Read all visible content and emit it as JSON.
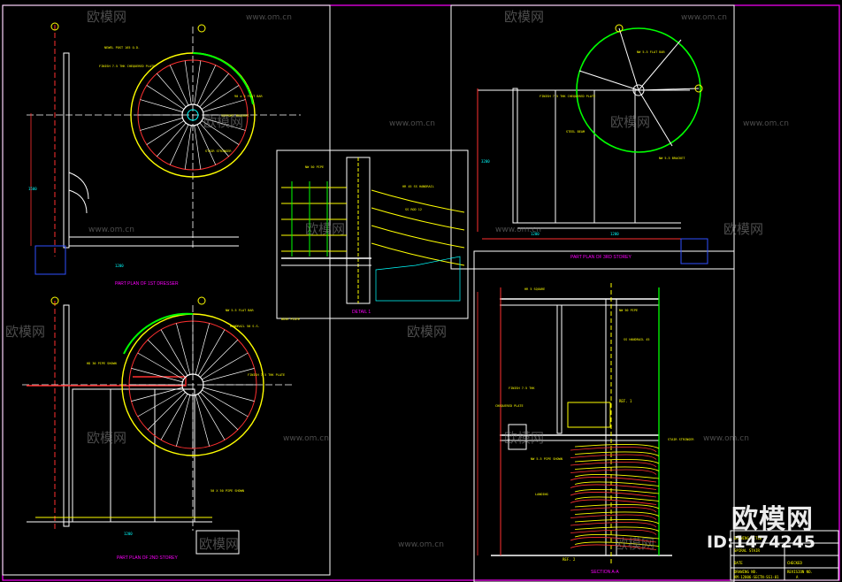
{
  "drawing": {
    "plan_titles": [
      "PART PLAN OF 1ST DRESSER",
      "PART PLAN OF 2ND STOREY",
      "PART PLAN OF 3RD STOREY"
    ],
    "section_title": "SECTION A-A",
    "detail_title": "DETAIL 1",
    "scale_note": "SCALE 1:50",
    "ref_labels": [
      "REF. 1",
      "REF. 2"
    ],
    "grid_bubbles": [
      "B",
      "C",
      "D"
    ],
    "dims": [
      "1200",
      "1200",
      "1500",
      "3200",
      "1200",
      "1200"
    ]
  },
  "title_block": {
    "rows": [
      "DRAWING TITLE",
      "SPIRAL STAIR",
      "DATE",
      "CHECKED",
      "DRAWING NO.",
      "REVISION NO.",
      "KM-12006-SECTN-SS1-01",
      "A"
    ]
  },
  "watermark": {
    "brand": "欧模网",
    "site": "www.om.cn",
    "id_label": "ID:1474245"
  },
  "colors": {
    "background": "#000000",
    "frame": "#ff00ff",
    "stair_yellow": "#ffff00",
    "stair_red": "#ff3030",
    "wall_green": "#00ff00",
    "dim_cyan": "#00ffff",
    "white": "#ffffff"
  }
}
